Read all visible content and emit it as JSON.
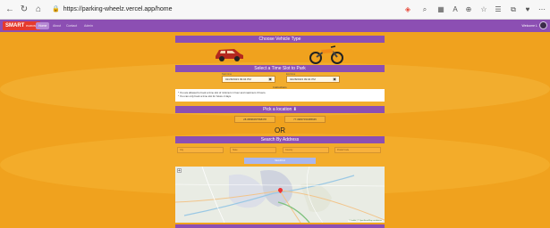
{
  "browser": {
    "url": "https://parking-wheelz.vercel.app/home"
  },
  "navbar": {
    "logo_text": "SMART",
    "logo_sub": "PARKING",
    "links": [
      "Home",
      "About",
      "Contact",
      "Admin"
    ],
    "welcome": "Welcome L"
  },
  "vehicle": {
    "title": "Choose Vehicle Type"
  },
  "time_slot": {
    "title": "Select a Time Slot to Park",
    "start_label": "Start time",
    "start_value": "02/28/2023 09:04 PM",
    "end_label": "End time",
    "end_value": "02/28/2023 09:04 PM",
    "instructions_title": "Instructions",
    "instructions": [
      "* You are allowed to book a time slot of minimum 1 hour and maximum 3 hours.",
      "* You can only book a time slot for future 2 days."
    ]
  },
  "location": {
    "title": "Pick a location",
    "lat": "28.45896457568478",
    "lng": "77.49807154385945"
  },
  "or_text": "OR",
  "address": {
    "title": "Search By Address",
    "city_placeholder": "City",
    "state_placeholder": "State",
    "country_placeholder": "Country",
    "postal_placeholder": "Postal Code",
    "search_label": "SEARCH",
    "attribution": "© Leaflet | © OpenStreetMap contributors"
  },
  "colors": {
    "accent": "#8c4fb3",
    "background": "#f0a21e"
  }
}
